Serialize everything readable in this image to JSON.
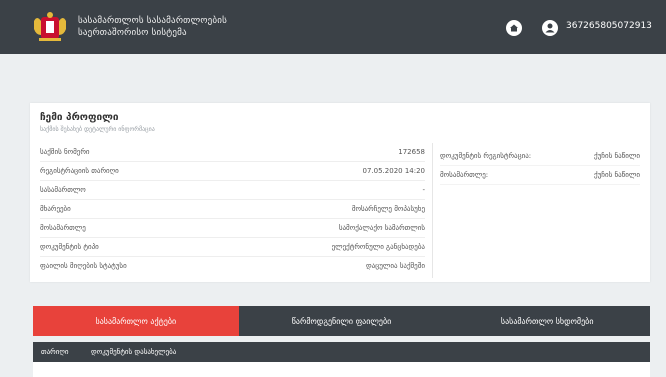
{
  "header": {
    "brand_line1": "სასამართლოს სასამართლოების",
    "brand_line2": "საერთაშორისო სისტემა",
    "user_id": "367265805072913"
  },
  "card": {
    "title": "ჩემი პროფილი",
    "subtitle": "საქმის შესახებ დეტალური ინფორმაცია",
    "rows": [
      {
        "label": "საქმის ნომერი",
        "value": "172658"
      },
      {
        "label": "რეგისტრაციის თარიღი",
        "value": "07.05.2020 14:20"
      },
      {
        "label": "სასამართლო",
        "value": "-"
      },
      {
        "label": "მხარეები",
        "value": "მოსარჩელე მოპასუხე"
      },
      {
        "label": "მოსამართლე",
        "value": "სამოქალაქო სამართლის"
      },
      {
        "label": "დოკუმენტის ტიპი",
        "value": "ელექტრონული განცხადება"
      },
      {
        "label": "ფაილის მიღების სტატუსი",
        "value": "დაცულია საქმეში"
      }
    ],
    "right_rows": [
      {
        "label": "დოკუმენტის რეგისტრაცია:",
        "value": "ქუჩის ნაწილი"
      },
      {
        "label": "მოსამართლე:",
        "value": "ქუჩის ნაწილი"
      }
    ]
  },
  "tabs": [
    {
      "label": "სასამართლო აქტები"
    },
    {
      "label": "წარმოდგენილი ფაილები"
    },
    {
      "label": "სასამართლო სხდომები"
    }
  ],
  "table": {
    "col1": "თარიღი",
    "col2": "დოკუმენტის დასახელება"
  },
  "colors": {
    "header_bg": "#3b4147",
    "accent": "#e8423b"
  }
}
